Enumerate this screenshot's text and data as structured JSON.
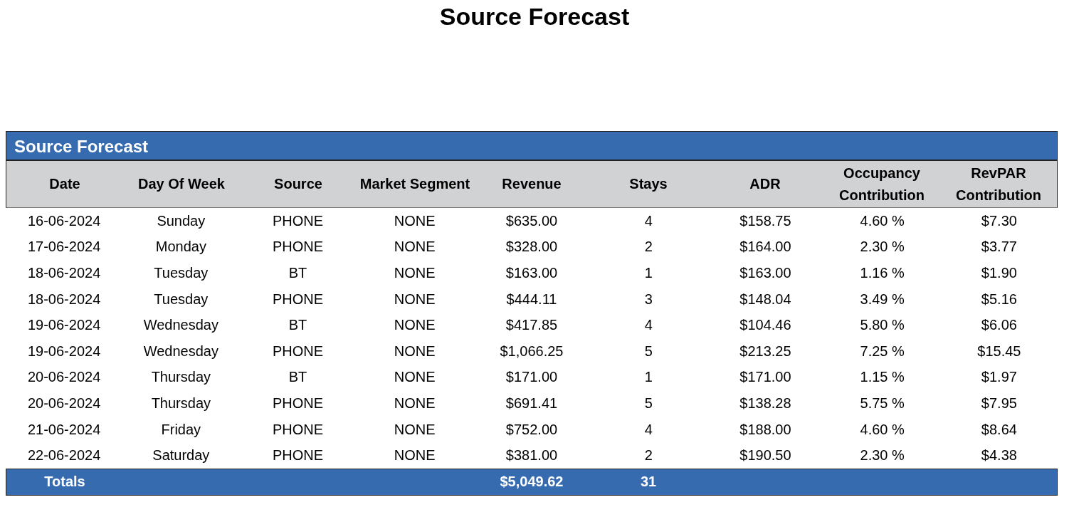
{
  "page_title": "Source Forecast",
  "table": {
    "title": "Source Forecast",
    "columns": [
      "Date",
      "Day Of Week",
      "Source",
      "Market Segment",
      "Revenue",
      "Stays",
      "ADR",
      "Occupancy Contribution",
      "RevPAR Contribution"
    ],
    "rows": [
      [
        "16-06-2024",
        "Sunday",
        "PHONE",
        "NONE",
        "$635.00",
        "4",
        "$158.75",
        "4.60 %",
        "$7.30"
      ],
      [
        "17-06-2024",
        "Monday",
        "PHONE",
        "NONE",
        "$328.00",
        "2",
        "$164.00",
        "2.30 %",
        "$3.77"
      ],
      [
        "18-06-2024",
        "Tuesday",
        "BT",
        "NONE",
        "$163.00",
        "1",
        "$163.00",
        "1.16 %",
        "$1.90"
      ],
      [
        "18-06-2024",
        "Tuesday",
        "PHONE",
        "NONE",
        "$444.11",
        "3",
        "$148.04",
        "3.49 %",
        "$5.16"
      ],
      [
        "19-06-2024",
        "Wednesday",
        "BT",
        "NONE",
        "$417.85",
        "4",
        "$104.46",
        "5.80 %",
        "$6.06"
      ],
      [
        "19-06-2024",
        "Wednesday",
        "PHONE",
        "NONE",
        "$1,066.25",
        "5",
        "$213.25",
        "7.25 %",
        "$15.45"
      ],
      [
        "20-06-2024",
        "Thursday",
        "BT",
        "NONE",
        "$171.00",
        "1",
        "$171.00",
        "1.15 %",
        "$1.97"
      ],
      [
        "20-06-2024",
        "Thursday",
        "PHONE",
        "NONE",
        "$691.41",
        "5",
        "$138.28",
        "5.75 %",
        "$7.95"
      ],
      [
        "21-06-2024",
        "Friday",
        "PHONE",
        "NONE",
        "$752.00",
        "4",
        "$188.00",
        "4.60 %",
        "$8.64"
      ],
      [
        "22-06-2024",
        "Saturday",
        "PHONE",
        "NONE",
        "$381.00",
        "2",
        "$190.50",
        "2.30 %",
        "$4.38"
      ]
    ],
    "totals": {
      "label": "Totals",
      "revenue": "$5,049.62",
      "stays": "31"
    }
  }
}
